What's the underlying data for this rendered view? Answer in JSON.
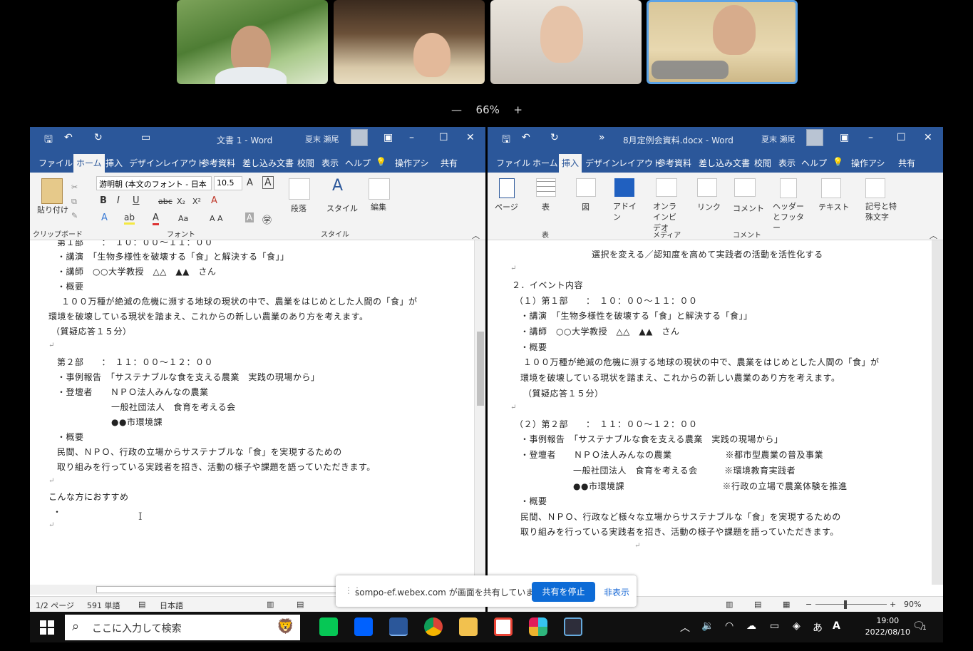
{
  "meeting": {
    "zoom_level": "66%",
    "zoom_out": "—",
    "zoom_in": "+"
  },
  "left_window": {
    "title": "文書 1 - Word",
    "user": "夏末 瀬尾",
    "tabs": [
      "ファイル",
      "ホーム",
      "挿入",
      "デザイン",
      "レイアウト",
      "参考資料",
      "差し込み文書",
      "校閲",
      "表示",
      "ヘルプ",
      "操作アシ",
      "共有"
    ],
    "active_tab": "ホーム",
    "ribbon": {
      "paste": "貼り付け",
      "clipboard": "クリップボード",
      "font_name": "游明朝 (本文のフォント - 日本",
      "font_size": "10.5",
      "font_group": "フォント",
      "paragraph": "段落",
      "style": "スタイル",
      "style_group": "スタイル",
      "edit": "編集"
    },
    "doc_lines": [
      "第１部　　：　１０：００～１１：００",
      "・講演　「生物多様性を破壊する「食」と解決する「食」」",
      "・講師　○○大学教授　△△　▲▲　さん",
      "・概要",
      "１００万種が絶滅の危機に瀕する地球の現状の中で、農業をはじめとした人間の「食」が",
      "環境を破壊している現状を踏まえ、これからの新しい農業のあり方を考えます。",
      "（質疑応答１５分）",
      "",
      "第２部　　：　１１：００～１２：００",
      "・事例報告　「サステナブルな食を支える農業　実践の現場から」",
      "・登壇者　　ＮＰＯ法人みんなの農業",
      "一般社団法人　食育を考える会",
      "●●市環境課",
      "・概要",
      "民間、ＮＰＯ、行政の立場からサステナブルな「食」を実現するための",
      "取り組みを行っている実践者を招き、活動の様子や課題を語っていただきます。",
      "",
      "こんな方におすすめ",
      "・"
    ],
    "status": {
      "page": "1/2 ページ",
      "words": "591 単語",
      "lang": "日本語"
    }
  },
  "right_window": {
    "title": "8月定例会資料.docx - Word",
    "user": "夏末 瀬尾",
    "tabs": [
      "ファイル",
      "ホーム",
      "挿入",
      "デザイン",
      "レイアウト",
      "参考資料",
      "差し込み文書",
      "校閲",
      "表示",
      "ヘルプ",
      "操作アシ",
      "共有"
    ],
    "active_tab": "挿入",
    "ribbon": {
      "page": "ページ",
      "table": "表",
      "table_group": "表",
      "figure": "図",
      "addin": "アドイン",
      "online_video": "オンラインビデオ",
      "media": "メディア",
      "link": "リンク",
      "comment": "コメント",
      "comment_group": "コメント",
      "header_footer": "ヘッダーとフッター",
      "text": "テキスト",
      "symbols": "記号と特殊文字"
    },
    "doc_lines": [
      "選択を変える／認知度を高めて実践者の活動を活性化する",
      "",
      "２．イベント内容",
      "（１）第１部　　：　１０：００～１１：００",
      "・講演　「生物多様性を破壊する「食」と解決する「食」」",
      "・講師　○○大学教授　△△　▲▲　さん",
      "・概要",
      "１００万種が絶滅の危機に瀕する地球の現状の中で、農業をはじめとした人間の「食」が",
      "環境を破壊している現状を踏まえ、これからの新しい農業のあり方を考えます。",
      "（質疑応答１５分）",
      "",
      "（２）第２部　　：　１１：００～１２：００",
      "・事例報告　「サステナブルな食を支える農業　実践の現場から」",
      "・登壇者　　ＮＰＯ法人みんなの農業　　　　　　※都市型農業の普及事業",
      "一般社団法人　食育を考える会　　　※環境教育実践者",
      "●●市環境課　　　　　　　　　　　※行政の立場で農業体験を推進",
      "・概要",
      "民間、ＮＰＯ、行政など様々な立場からサステナブルな「食」を実現するための",
      "取り組みを行っている実践者を招き、活動の様子や課題を語っていただきます。"
    ],
    "status": {
      "zoom": "90%"
    }
  },
  "share_banner": {
    "text": "sompo-ef.webex.com が画面を共有しています。",
    "stop": "共有を停止",
    "hide": "非表示"
  },
  "taskbar": {
    "search_placeholder": "ここに入力して検索",
    "time": "19:00",
    "date": "2022/08/10",
    "ime": "あ",
    "notifications": "1"
  }
}
